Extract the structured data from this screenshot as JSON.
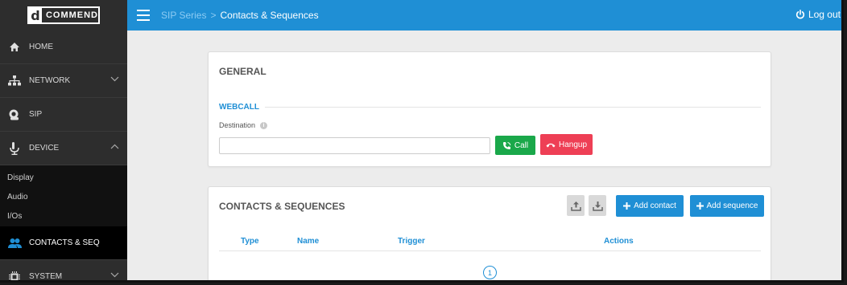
{
  "brand": {
    "logo_mark": "d",
    "logo_text": "COMMEND"
  },
  "sidebar": {
    "items": [
      {
        "label": "HOME",
        "icon": "home-icon"
      },
      {
        "label": "NETWORK",
        "icon": "network-icon",
        "chevron": "down"
      },
      {
        "label": "SIP",
        "icon": "sip-icon"
      },
      {
        "label": "DEVICE",
        "icon": "device-icon",
        "chevron": "up"
      }
    ],
    "device_sub": [
      "Display",
      "Audio",
      "I/Os"
    ],
    "active": {
      "label": "CONTACTS & SEQ",
      "icon": "contacts-icon"
    },
    "system": {
      "label": "SYSTEM",
      "icon": "system-icon",
      "chevron": "down"
    }
  },
  "topbar": {
    "breadcrumb_root": "SIP Series",
    "breadcrumb_sep": ">",
    "breadcrumb_current": "Contacts & Sequences",
    "logout_label": "Log out"
  },
  "general": {
    "title": "GENERAL",
    "webcall_title": "WEBCALL",
    "destination_label": "Destination",
    "destination_value": "",
    "call_label": "Call",
    "hangup_label": "Hangup"
  },
  "contacts": {
    "title": "CONTACTS & SEQUENCES",
    "add_contact_label": "Add contact",
    "add_sequence_label": "Add sequence",
    "columns": [
      "Type",
      "Name",
      "Trigger",
      "Actions"
    ],
    "page": "1"
  },
  "colors": {
    "accent": "#1f8fd5",
    "call": "#1aa84a",
    "hangup": "#ee3f55",
    "sidebar": "#2d2d2d"
  }
}
